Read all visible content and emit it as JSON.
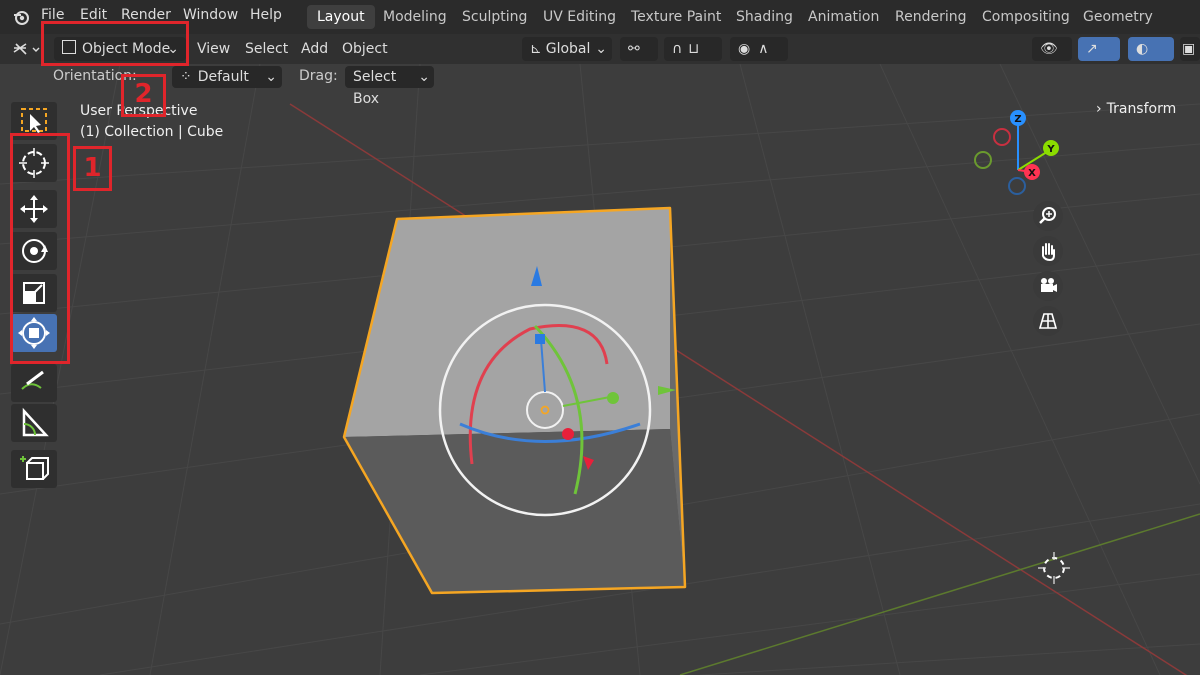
{
  "menus": [
    "File",
    "Edit",
    "Render",
    "Window",
    "Help"
  ],
  "workspaces": [
    {
      "label": "Layout",
      "active": true
    },
    {
      "label": "Modeling",
      "active": false
    },
    {
      "label": "Sculpting",
      "active": false
    },
    {
      "label": "UV Editing",
      "active": false
    },
    {
      "label": "Texture Paint",
      "active": false
    },
    {
      "label": "Shading",
      "active": false
    },
    {
      "label": "Animation",
      "active": false
    },
    {
      "label": "Rendering",
      "active": false
    },
    {
      "label": "Compositing",
      "active": false
    },
    {
      "label": "Geometry Nodes",
      "active": false
    }
  ],
  "header": {
    "mode": "Object Mode",
    "menu_items": [
      "View",
      "Select",
      "Add",
      "Object"
    ],
    "transform_orientation": "Global"
  },
  "tool_settings": {
    "orientation_label": "Orientation:",
    "orientation_value": "Default",
    "drag_label": "Drag:",
    "drag_value": "Select Box"
  },
  "viewport": {
    "view_name": "User Perspective",
    "collection_info": "(1) Collection | Cube",
    "transform_panel": "Transform"
  },
  "gizmo_axes": {
    "x": "X",
    "y": "Y",
    "z": "Z"
  },
  "annotations": {
    "box1": "1",
    "box2": "2"
  },
  "colors": {
    "accent_blue": "#4772b3",
    "selection_orange": "#f5a623",
    "annotation_red": "#e0252b",
    "axis_x": "#ff3352",
    "axis_y": "#8bdc00",
    "axis_z": "#2890ff"
  }
}
